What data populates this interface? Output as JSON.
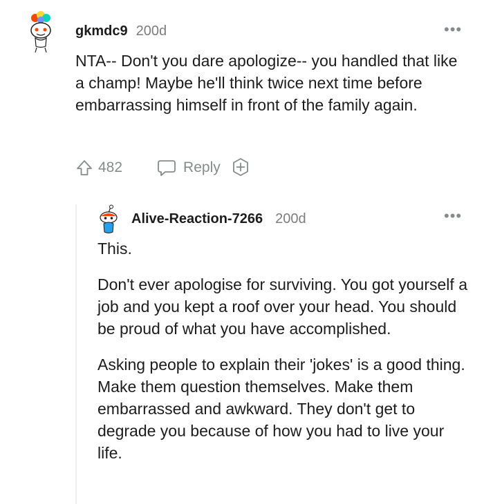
{
  "comments": [
    {
      "username": "gkmdc9",
      "timestamp": "200d",
      "more_icon": "more-options-icon",
      "paragraphs": [
        "NTA-- Don't you dare apologize-- you handled that like a champ! Maybe he'll think twice next time before embarrassing himself in front of the family again."
      ],
      "upvotes": "482",
      "reply_label": "Reply",
      "award_icon": "add-award-icon"
    },
    {
      "username": "Alive-Reaction-7266",
      "timestamp": "200d",
      "more_icon": "more-options-icon",
      "paragraphs": [
        "This.",
        "Don't ever apologise for surviving. You got yourself a job and you kept a roof over your head. You should be proud of what you have accomplished.",
        "Asking people to explain their 'jokes' is a good thing. Make them question themselves. Make them embarrassed and awkward. They don't get to degrade you because of how you had to live your life."
      ]
    }
  ],
  "colors": {
    "text": "#1c1c1c",
    "meta": "#7c7c7c",
    "icon": "#878a8c",
    "thread_line": "#edeff1"
  }
}
